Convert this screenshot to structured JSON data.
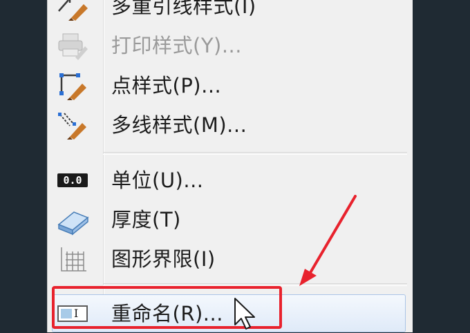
{
  "menu": {
    "items": [
      {
        "label": "多重引线样式(I)",
        "icon": "multileader-style-icon",
        "enabled": true
      },
      {
        "label": "打印样式(Y)...",
        "icon": "print-style-icon",
        "enabled": false
      },
      {
        "label": "点样式(P)...",
        "icon": "point-style-icon",
        "enabled": true
      },
      {
        "label": "多线样式(M)...",
        "icon": "multiline-style-icon",
        "enabled": true
      },
      {
        "label": "单位(U)...",
        "icon": "units-icon",
        "icon_text": "0.0",
        "enabled": true
      },
      {
        "label": "厚度(T)",
        "icon": "thickness-icon",
        "enabled": true
      },
      {
        "label": "图形界限(I)",
        "icon": "drawing-limits-icon",
        "enabled": true
      },
      {
        "label": "重命名(R)...",
        "icon": "rename-icon",
        "icon_text": "I",
        "enabled": true,
        "hovered": true
      }
    ]
  },
  "annotation": {
    "highlight_color": "#e8222d"
  }
}
